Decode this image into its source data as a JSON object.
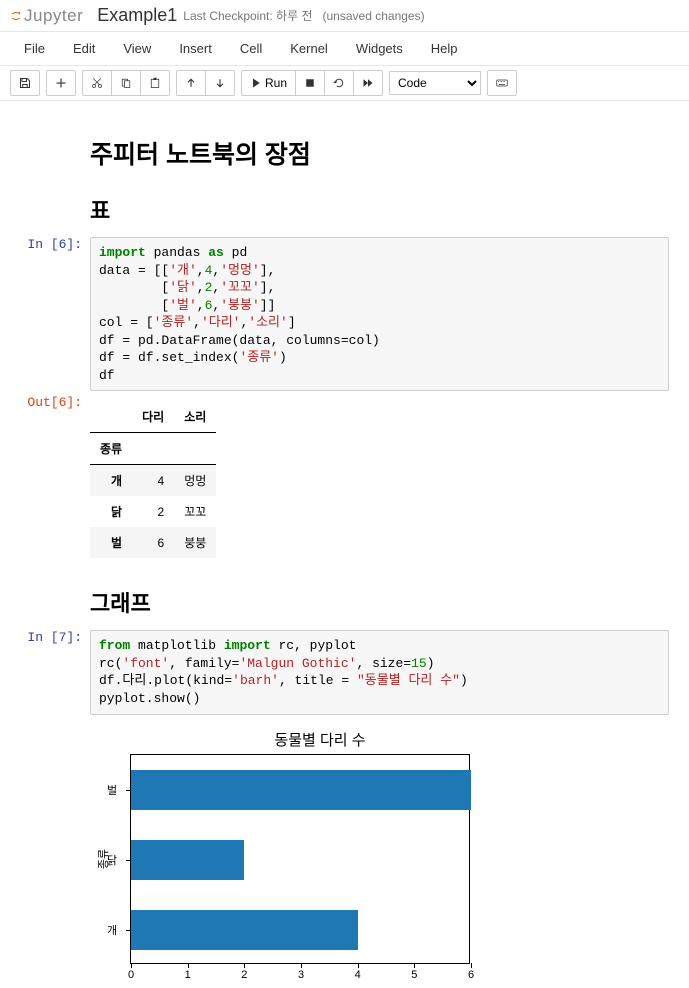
{
  "header": {
    "logo": "Jupyter",
    "title": "Example1",
    "checkpoint_prefix": "Last Checkpoint:",
    "checkpoint_time": "하루 전",
    "checkpoint_status": "(unsaved changes)"
  },
  "menu": [
    "File",
    "Edit",
    "View",
    "Insert",
    "Cell",
    "Kernel",
    "Widgets",
    "Help"
  ],
  "toolbar": {
    "run_label": "Run",
    "celltype": "Code"
  },
  "cells": {
    "h1": "주피터 노트북의 장점",
    "h2_table": "표",
    "h2_chart": "그래프",
    "in6_prompt": "In [6]:",
    "out6_prompt": "Out[6]:",
    "in7_prompt": "In [7]:",
    "code6": {
      "l1a": "import",
      "l1b": " pandas ",
      "l1c": "as",
      "l1d": " pd",
      "l2a": "data = [[",
      "l2b": "'개'",
      "l2c": ",",
      "l2d": "4",
      "l2e": ",",
      "l2f": "'멍멍'",
      "l2g": "],",
      "l3a": "        [",
      "l3b": "'닭'",
      "l3c": ",",
      "l3d": "2",
      "l3e": ",",
      "l3f": "'꼬꼬'",
      "l3g": "],",
      "l4a": "        [",
      "l4b": "'벌'",
      "l4c": ",",
      "l4d": "6",
      "l4e": ",",
      "l4f": "'붕붕'",
      "l4g": "]]",
      "l5a": "col = [",
      "l5b": "'종류'",
      "l5c": ",",
      "l5d": "'다리'",
      "l5e": ",",
      "l5f": "'소리'",
      "l5g": "]",
      "l6a": "df = pd.DataFrame(data, columns=col)",
      "l7a": "df = df.set_index(",
      "l7b": "'종류'",
      "l7c": ")",
      "l8a": "df"
    },
    "table": {
      "cols": [
        "다리",
        "소리"
      ],
      "index_name": "종류",
      "rows": [
        {
          "idx": "개",
          "c1": "4",
          "c2": "멍멍"
        },
        {
          "idx": "닭",
          "c1": "2",
          "c2": "꼬꼬"
        },
        {
          "idx": "벌",
          "c1": "6",
          "c2": "붕붕"
        }
      ]
    },
    "code7": {
      "l1a": "from",
      "l1b": " matplotlib ",
      "l1c": "import",
      "l1d": " rc, pyplot",
      "l2a": "rc(",
      "l2b": "'font'",
      "l2c": ", family=",
      "l2d": "'Malgun Gothic'",
      "l2e": ", size=",
      "l2f": "15",
      "l2g": ")",
      "l3a": "df.다리.plot(kind=",
      "l3b": "'barh'",
      "l3c": ", title = ",
      "l3d": "\"동물별 다리 수\"",
      "l3e": ")",
      "l4a": "pyplot.show()"
    }
  },
  "chart_data": {
    "type": "bar",
    "orientation": "horizontal",
    "title": "동물별 다리 수",
    "ylabel": "종류",
    "categories": [
      "벌",
      "닭",
      "개"
    ],
    "values": [
      6,
      2,
      4
    ],
    "xlim": [
      0,
      6
    ],
    "xticks": [
      0,
      1,
      2,
      3,
      4,
      5,
      6
    ],
    "color": "#1f77b4"
  }
}
